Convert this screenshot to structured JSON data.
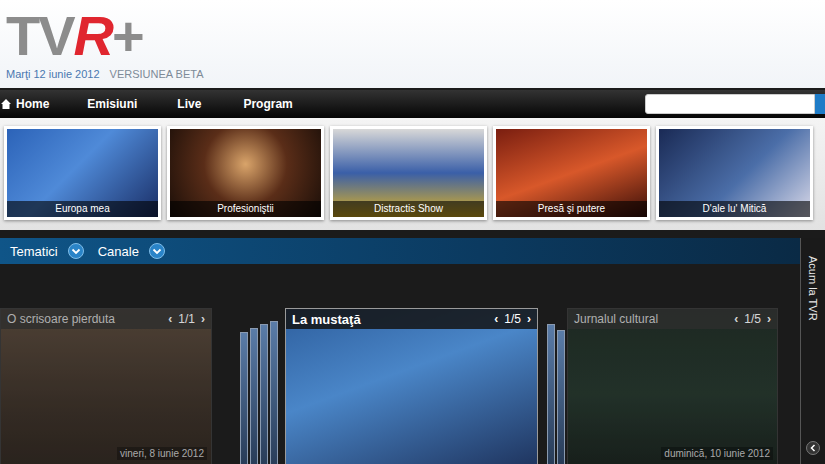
{
  "header": {
    "logo": [
      {
        "text": "TV",
        "color": "#8c8c8c"
      },
      {
        "text": "R",
        "color": "#e0262f"
      },
      {
        "text": "+",
        "color": "#8c8c8c"
      }
    ],
    "date": "Marţi 12 iunie 2012",
    "edition": "VERSIUNEA BETA"
  },
  "nav": {
    "items": [
      {
        "label": "Home",
        "selected": false
      },
      {
        "label": "Emisiuni",
        "selected": false
      },
      {
        "label": "Live",
        "selected": false
      },
      {
        "label": "Program",
        "selected": false
      }
    ]
  },
  "search": {
    "placeholder": ""
  },
  "featured": [
    {
      "caption": "Europa mea"
    },
    {
      "caption": "Profesioniştii"
    },
    {
      "caption": "Distractis Show"
    },
    {
      "caption": "Presă şi putere"
    },
    {
      "caption": "D'ale lu' Mitică"
    }
  ],
  "filters": [
    {
      "label": "Tematici",
      "expanded": false
    },
    {
      "label": "Canale",
      "expanded": false
    }
  ],
  "side_tab": {
    "label": "Acum la TVR"
  },
  "pager_arrows": {
    "prev": "‹",
    "next": "›"
  },
  "carousel": [
    {
      "title": "O scrisoare pierduta",
      "page": "1/1",
      "date": "vineri, 8 iunie 2012",
      "selected": false
    },
    {
      "title": "La mustaţă",
      "page": "1/5",
      "selected": true
    },
    {
      "title": "Jurnalul cultural",
      "page": "1/5",
      "date": "duminică, 10 iunie 2012",
      "selected": false
    }
  ]
}
